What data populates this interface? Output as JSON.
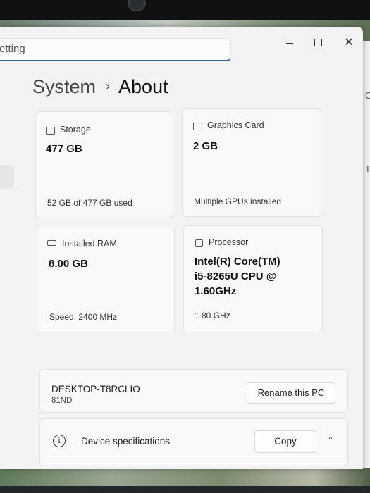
{
  "window": {
    "search_text": "etting",
    "caption": {
      "min": "—",
      "max": "□",
      "close": "✕"
    }
  },
  "breadcrumb": {
    "parent": "System",
    "separator": "›",
    "current": "About"
  },
  "cards": {
    "storage": {
      "icon": "storage-icon",
      "label": "Storage",
      "value": "477 GB",
      "detail": "52 GB of 477 GB used"
    },
    "graphics": {
      "icon": "graphics-card-icon",
      "label": "Graphics Card",
      "value": "2 GB",
      "detail": "Multiple GPUs installed"
    },
    "ram": {
      "icon": "ram-icon",
      "label": "Installed RAM",
      "value": "8.00 GB",
      "detail": "Speed: 2400 MHz"
    },
    "processor": {
      "icon": "processor-icon",
      "label": "Processor",
      "value_lines": [
        "Intel(R) Core(TM)",
        "i5-8265U CPU @",
        "1.60GHz"
      ],
      "detail": "1.80 GHz"
    }
  },
  "device": {
    "name": "DESKTOP-T8RCLIO",
    "model": "81ND",
    "rename_label": "Rename this PC"
  },
  "specs": {
    "label": "Device specifications",
    "copy_label": "Copy",
    "chevron": "^"
  },
  "background_glyphs": [
    "C",
    "I"
  ]
}
